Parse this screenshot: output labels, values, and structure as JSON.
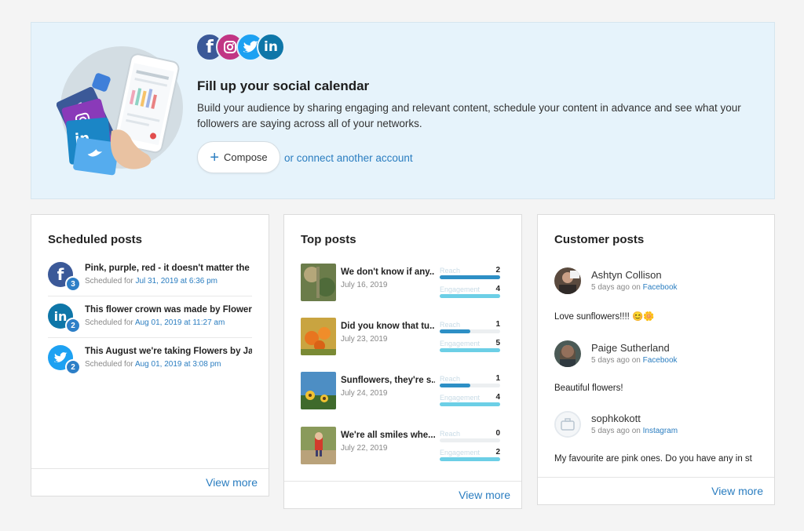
{
  "banner": {
    "social_icons": [
      "facebook-icon",
      "instagram-icon",
      "twitter-icon",
      "linkedin-icon"
    ],
    "title": "Fill up your social calendar",
    "description": "Build your audience by sharing engaging and relevant content, schedule your content in advance and see what your followers are saying across all of your networks.",
    "compose_label": "Compose",
    "connect_link": "or connect another account"
  },
  "scheduled": {
    "title": "Scheduled posts",
    "items": [
      {
        "network": "facebook",
        "count": "3",
        "text": "Pink, purple, red - it doesn't matter the c",
        "prefix": "Scheduled for",
        "date": "Jul 31, 2019 at 6:36 pm"
      },
      {
        "network": "linkedin",
        "count": "2",
        "text": "This flower crown was made by Flowers",
        "prefix": "Scheduled for",
        "date": "Aug 01, 2019 at 11:27 am"
      },
      {
        "network": "twitter",
        "count": "2",
        "text": "This August we're taking Flowers by Jan",
        "prefix": "Scheduled for",
        "date": "Aug 01, 2019 at 3:08 pm"
      }
    ],
    "view_more": "View more"
  },
  "top_posts": {
    "title": "Top posts",
    "reach_label": "Reach",
    "engagement_label": "Engagement",
    "items": [
      {
        "text": "We don't know if any...",
        "date": "July 16, 2019",
        "reach": "2",
        "engagement": "4",
        "reach_fill": 1.0,
        "engagement_fill": 1.0
      },
      {
        "text": "Did you know that tu...",
        "date": "July 23, 2019",
        "reach": "1",
        "engagement": "5",
        "reach_fill": 0.5,
        "engagement_fill": 1.0
      },
      {
        "text": "Sunflowers, they're s...",
        "date": "July 24, 2019",
        "reach": "1",
        "engagement": "4",
        "reach_fill": 0.5,
        "engagement_fill": 1.0
      },
      {
        "text": "We're all smiles whe...",
        "date": "July 22, 2019",
        "reach": "0",
        "engagement": "2",
        "reach_fill": 0.0,
        "engagement_fill": 1.0
      }
    ],
    "view_more": "View more"
  },
  "customer_posts": {
    "title": "Customer posts",
    "items": [
      {
        "name": "Ashtyn Collison",
        "meta": "5 days ago on",
        "network": "Facebook",
        "body": "Love sunflowers!!!! 😊🌼"
      },
      {
        "name": "Paige Sutherland",
        "meta": "5 days ago on",
        "network": "Facebook",
        "body": "Beautiful flowers!"
      },
      {
        "name": "sophkokott",
        "meta": "5 days ago on",
        "network": "Instagram",
        "body": "My favourite are pink ones. Do you have any in st"
      }
    ],
    "view_more": "View more"
  },
  "colors": {
    "accent": "#2a7dc0",
    "facebook": "#3b5998",
    "linkedin": "#0e76a8",
    "twitter": "#1da1f2",
    "reach_bar": "#2d8fc5",
    "engagement_bar": "#6ccfe6"
  }
}
